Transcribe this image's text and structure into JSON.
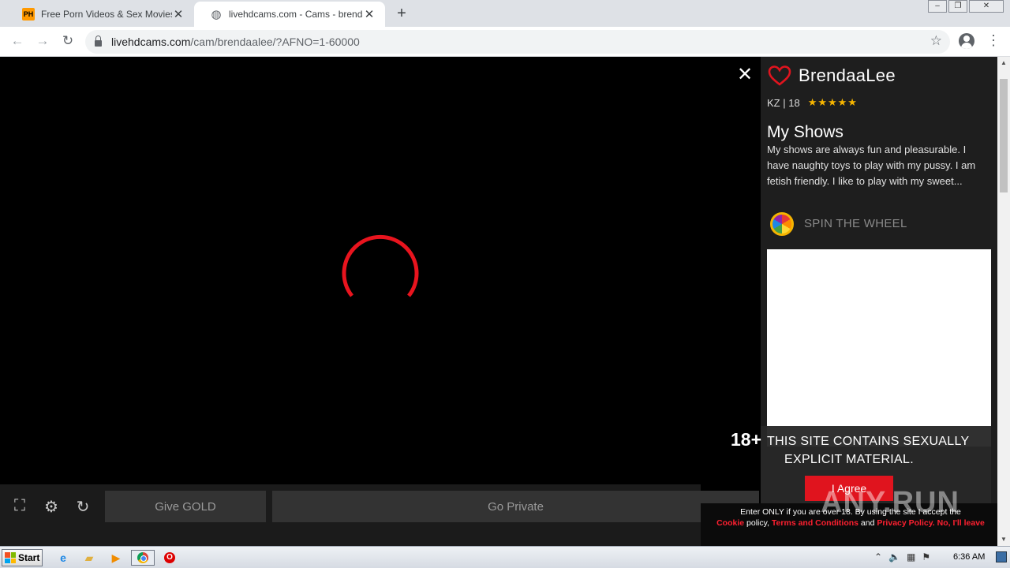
{
  "browser": {
    "tabs": [
      {
        "favicon": "PH",
        "title": "Free Porn Videos & Sex Movies - Porn",
        "active": false
      },
      {
        "favicon": "globe-icon",
        "title": "livehdcams.com - Cams - brendaalee",
        "active": true
      }
    ],
    "new_tab": "+",
    "url_host": "livehdcams.com",
    "url_path": "/cam/brendaalee/?AFNO=1-60000"
  },
  "player": {
    "controls": {
      "give_gold": "Give GOLD",
      "go_private": "Go Private"
    }
  },
  "profile": {
    "name": "BrendaaLee",
    "meta": "KZ | 18",
    "stars": "★★★★★",
    "shows_title": "My Shows",
    "shows_text": "My shows are always fun and pleasurable. I have naughty toys to play with my pussy. I am fetish friendly. I like to play with my sweet...",
    "spin_label": "SPIN THE WHEEL"
  },
  "age_gate": {
    "badge": "18+",
    "warning_line1": "THIS SITE CONTAINS SEXUALLY",
    "warning_line2": "EXPLICIT MATERIAL.",
    "agree": "I Agree",
    "consent_prefix": "Enter ONLY if you are over 18. By using the site I accept the",
    "cookie": "Cookie",
    "policy_word": " policy, ",
    "terms": "Terms and Conditions",
    "and_word": " and ",
    "privacy": "Privacy Policy.",
    "leave": " No, I'll leave"
  },
  "watermark": "ANY.RUN",
  "taskbar": {
    "start": "Start",
    "opera_glyph": "O",
    "clock": "6:36 AM"
  },
  "colors": {
    "accent_red": "#e0141e",
    "spinner_red": "#e8141e",
    "star_gold": "#f5b400"
  }
}
